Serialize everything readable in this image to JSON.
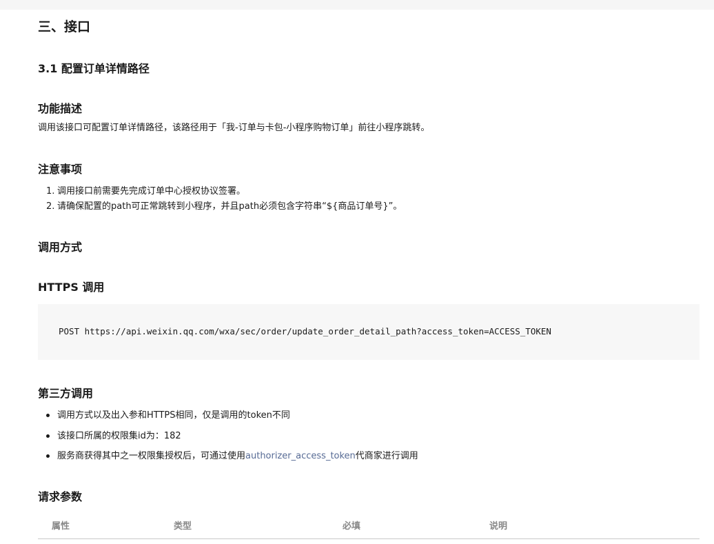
{
  "section_title": "三、接口",
  "subsection_title": "3.1 配置订单详情路径",
  "feature": {
    "heading": "功能描述",
    "text": "调用该接口可配置订单详情路径，该路径用于「我-订单与卡包-小程序购物订单」前往小程序跳转。"
  },
  "notes": {
    "heading": "注意事项",
    "items": [
      {
        "num": "1.",
        "text": "调用接口前需要先完成订单中心授权协议签署。"
      },
      {
        "num": "2.",
        "text": "请确保配置的path可正常跳转到小程序，并且path必须包含字符串“${商品订单号}”。"
      }
    ]
  },
  "call_method": {
    "heading": "调用方式"
  },
  "https_call": {
    "heading": "HTTPS 调用",
    "code": "POST https://api.weixin.qq.com/wxa/sec/order/update_order_detail_path?access_token=ACCESS_TOKEN"
  },
  "third_party": {
    "heading": "第三方调用",
    "item1": "调用方式以及出入参和HTTPS相同，仅是调用的token不同",
    "item2": "该接口所属的权限集id为：182",
    "item3_prefix": "服务商获得其中之一权限集授权后，可通过使用",
    "item3_link": "authorizer_access_token",
    "item3_suffix": "代商家进行调用"
  },
  "request_params": {
    "heading": "请求参数",
    "columns": [
      "属性",
      "类型",
      "必填",
      "说明"
    ]
  },
  "colors": {
    "link": "#576b95",
    "code_bg": "#f7f7f7",
    "table_header_text": "#888888"
  }
}
